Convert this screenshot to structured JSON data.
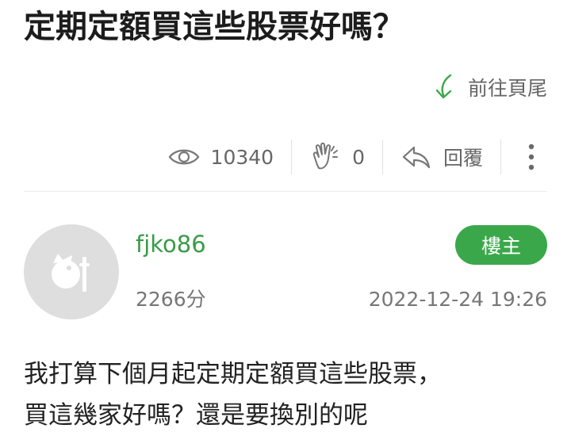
{
  "post": {
    "title": "定期定額買這些股票好嗎？",
    "goto_bottom_label": "前往頁尾",
    "stats": {
      "views": "10340",
      "claps": "0",
      "reply_label": "回覆"
    },
    "author": {
      "username": "fjko86",
      "score": "2266分",
      "badge": "樓主"
    },
    "timestamp": "2022-12-24 19:26",
    "body_lines": [
      "我打算下個月起定期定額買這些股票，",
      "買這幾家好嗎？還是要換別的呢"
    ]
  },
  "icons": {
    "goto_bottom": "arrow-down-curve-icon",
    "views": "eye-icon",
    "claps": "clap-hands-icon",
    "reply": "reply-arrow-icon",
    "more": "more-vertical-icon",
    "avatar": "default-avatar-icon"
  },
  "colors": {
    "accent_green": "#3aa84a",
    "username_green": "#3a9b48",
    "muted_text": "#666666",
    "avatar_bg": "#dedede"
  }
}
